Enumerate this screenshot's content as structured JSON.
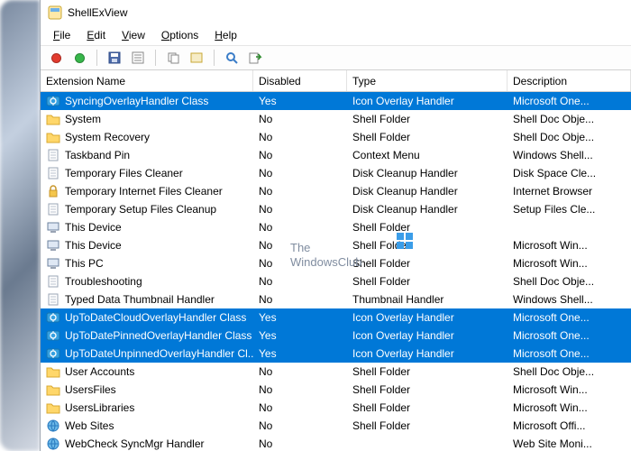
{
  "app": {
    "title": "ShellExView"
  },
  "menu": {
    "items": [
      {
        "label": "File",
        "accel": 0
      },
      {
        "label": "Edit",
        "accel": 0
      },
      {
        "label": "View",
        "accel": 0
      },
      {
        "label": "Options",
        "accel": 0
      },
      {
        "label": "Help",
        "accel": 0
      }
    ]
  },
  "columns": {
    "name": "Extension Name",
    "disabled": "Disabled",
    "type": "Type",
    "desc": "Description"
  },
  "rows": [
    {
      "icon": "sync",
      "name": "SyncingOverlayHandler Class",
      "disabled": "Yes",
      "type": "Icon Overlay Handler",
      "desc": "Microsoft One...",
      "selected": true
    },
    {
      "icon": "folder",
      "name": "System",
      "disabled": "No",
      "type": "Shell Folder",
      "desc": "Shell Doc Obje..."
    },
    {
      "icon": "folder",
      "name": "System Recovery",
      "disabled": "No",
      "type": "Shell Folder",
      "desc": "Shell Doc Obje..."
    },
    {
      "icon": "doc",
      "name": "Taskband Pin",
      "disabled": "No",
      "type": "Context Menu",
      "desc": "Windows Shell..."
    },
    {
      "icon": "doc",
      "name": "Temporary Files Cleaner",
      "disabled": "No",
      "type": "Disk Cleanup Handler",
      "desc": "Disk Space Cle..."
    },
    {
      "icon": "lock",
      "name": "Temporary Internet Files Cleaner",
      "disabled": "No",
      "type": "Disk Cleanup Handler",
      "desc": "Internet Browser"
    },
    {
      "icon": "doc",
      "name": "Temporary Setup Files Cleanup",
      "disabled": "No",
      "type": "Disk Cleanup Handler",
      "desc": "Setup Files Cle..."
    },
    {
      "icon": "pc",
      "name": "This Device",
      "disabled": "No",
      "type": "Shell Folder",
      "desc": ""
    },
    {
      "icon": "pc",
      "name": "This Device",
      "disabled": "No",
      "type": "Shell Folder",
      "desc": "Microsoft Win..."
    },
    {
      "icon": "pc",
      "name": "This PC",
      "disabled": "No",
      "type": "Shell Folder",
      "desc": "Microsoft Win..."
    },
    {
      "icon": "doc",
      "name": "Troubleshooting",
      "disabled": "No",
      "type": "Shell Folder",
      "desc": "Shell Doc Obje..."
    },
    {
      "icon": "doc",
      "name": "Typed Data Thumbnail Handler",
      "disabled": "No",
      "type": "Thumbnail Handler",
      "desc": "Windows Shell..."
    },
    {
      "icon": "sync",
      "name": "UpToDateCloudOverlayHandler Class",
      "disabled": "Yes",
      "type": "Icon Overlay Handler",
      "desc": "Microsoft One...",
      "selected": true
    },
    {
      "icon": "sync",
      "name": "UpToDatePinnedOverlayHandler Class",
      "disabled": "Yes",
      "type": "Icon Overlay Handler",
      "desc": "Microsoft One...",
      "selected": true
    },
    {
      "icon": "sync",
      "name": "UpToDateUnpinnedOverlayHandler Cl...",
      "disabled": "Yes",
      "type": "Icon Overlay Handler",
      "desc": "Microsoft One...",
      "selected": true
    },
    {
      "icon": "folder",
      "name": "User Accounts",
      "disabled": "No",
      "type": "Shell Folder",
      "desc": "Shell Doc Obje..."
    },
    {
      "icon": "folder",
      "name": "UsersFiles",
      "disabled": "No",
      "type": "Shell Folder",
      "desc": "Microsoft Win..."
    },
    {
      "icon": "folder",
      "name": "UsersLibraries",
      "disabled": "No",
      "type": "Shell Folder",
      "desc": "Microsoft Win..."
    },
    {
      "icon": "globe",
      "name": "Web Sites",
      "disabled": "No",
      "type": "Shell Folder",
      "desc": "Microsoft Offi..."
    },
    {
      "icon": "globe",
      "name": "WebCheck SyncMgr Handler",
      "disabled": "No",
      "type": "",
      "desc": "Web Site Moni..."
    }
  ],
  "watermark": {
    "line1": "The",
    "line2": "WindowsClub"
  }
}
